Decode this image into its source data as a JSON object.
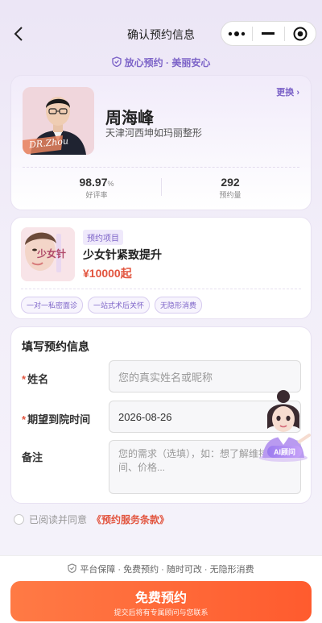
{
  "header": {
    "title": "确认预约信息",
    "capsule": {
      "more_icon": "ellipsis-icon",
      "minimize_icon": "minus-icon",
      "close_icon": "target-icon"
    }
  },
  "assurance": "放心预约 · 美丽安心",
  "doctor": {
    "name": "周海峰",
    "clinic": "天津河西坤如玛丽整形",
    "change_label": "更换 ›",
    "avatar_tag": "DR.Zhou",
    "rating_value": "98.97",
    "rating_unit": "%",
    "rating_label": "好评率",
    "bookings_value": "292",
    "bookings_label": "预约量"
  },
  "project": {
    "tag": "预约项目",
    "name": "少女针紧致提升",
    "price": "¥10000起",
    "image_text": "少女针",
    "chips": [
      "一对一私密面诊",
      "一站式术后关怀",
      "无隐形消费"
    ]
  },
  "form": {
    "title": "填写预约信息",
    "name_label": "姓名",
    "name_placeholder": "您的真实姓名或昵称",
    "date_label": "期望到院时间",
    "date_value": "2026-08-26",
    "note_label": "备注",
    "note_placeholder": "您的需求（选填），如：想了解维持时间、价格..."
  },
  "ai": {
    "badge": "AI顾问"
  },
  "agreement": {
    "prefix": "已阅读并同意",
    "link": "《预约服务条款》"
  },
  "footer": {
    "guarantee": "平台保障 · 免费预约 · 随时可改 · 无隐形消费",
    "cta_label": "免费预约",
    "cta_sub": "提交后将有专属顾问与您联系"
  },
  "colors": {
    "accent": "#7d64c8",
    "price": "#e2553f",
    "cta": "#ff6a3a"
  }
}
